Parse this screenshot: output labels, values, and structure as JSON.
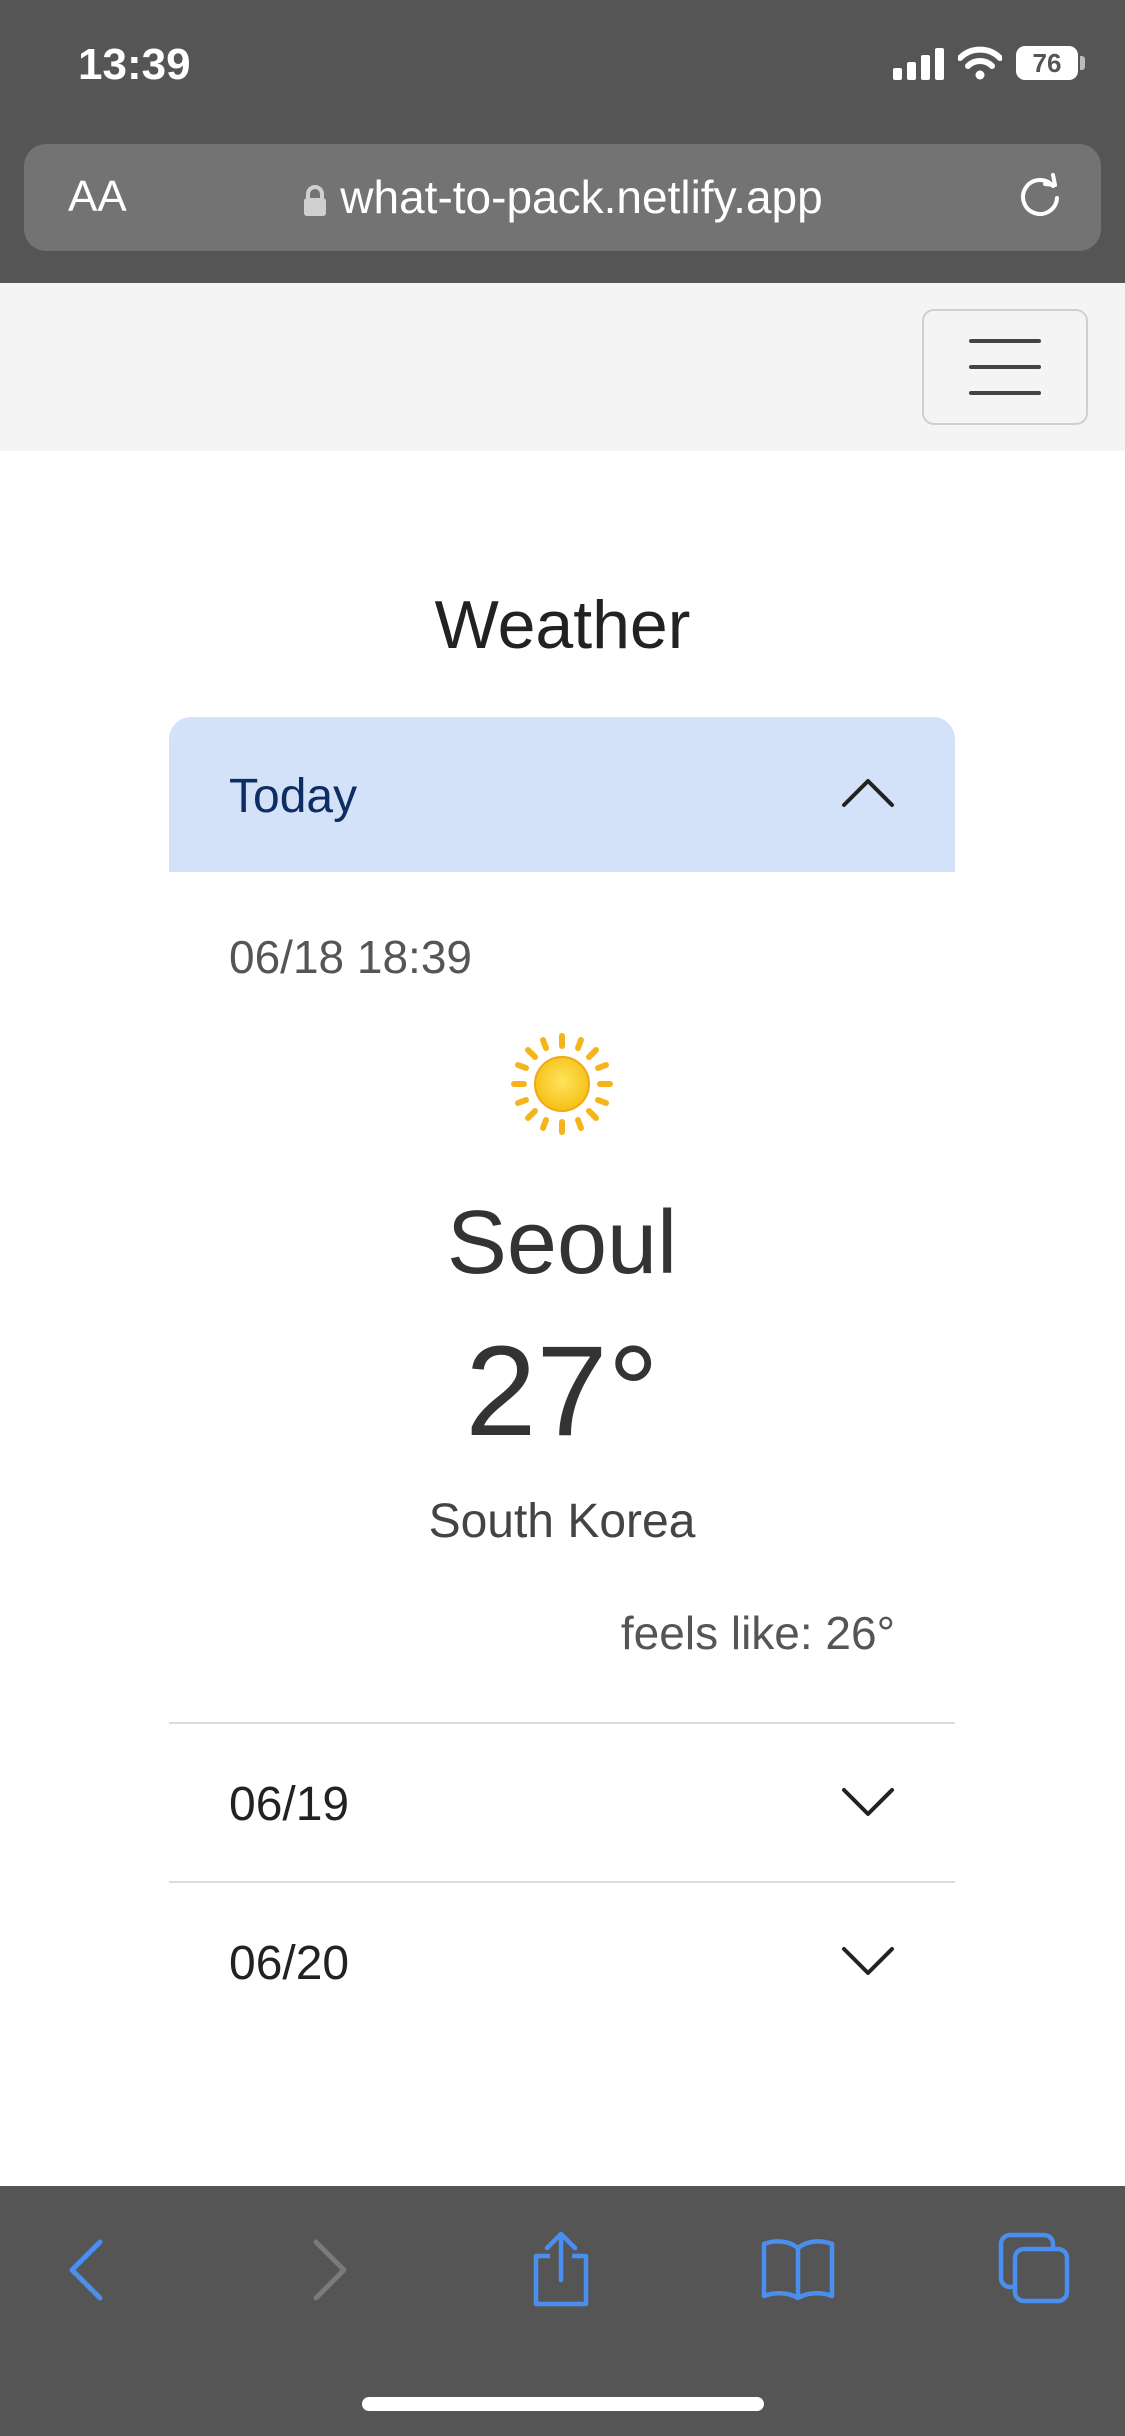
{
  "status_bar": {
    "time": "13:39",
    "battery": "76"
  },
  "browser": {
    "text_size_label": "AA",
    "url": "what-to-pack.netlify.app"
  },
  "page": {
    "title": "Weather",
    "today": {
      "label": "Today",
      "datetime": "06/18  18:39",
      "icon": "sun-icon",
      "city": "Seoul",
      "temperature": "27°",
      "country": "South Korea",
      "feels_like": "feels like: 26°"
    },
    "forecast_days": [
      {
        "label": "06/19"
      },
      {
        "label": "06/20"
      }
    ]
  },
  "colors": {
    "chrome_bg": "#555555",
    "accordion_active_bg": "#d3e2f9",
    "accordion_active_text": "#0d2d63",
    "toolbar_icon_active": "#4a8ff0",
    "toolbar_icon_disabled": "#7a7a7a"
  }
}
